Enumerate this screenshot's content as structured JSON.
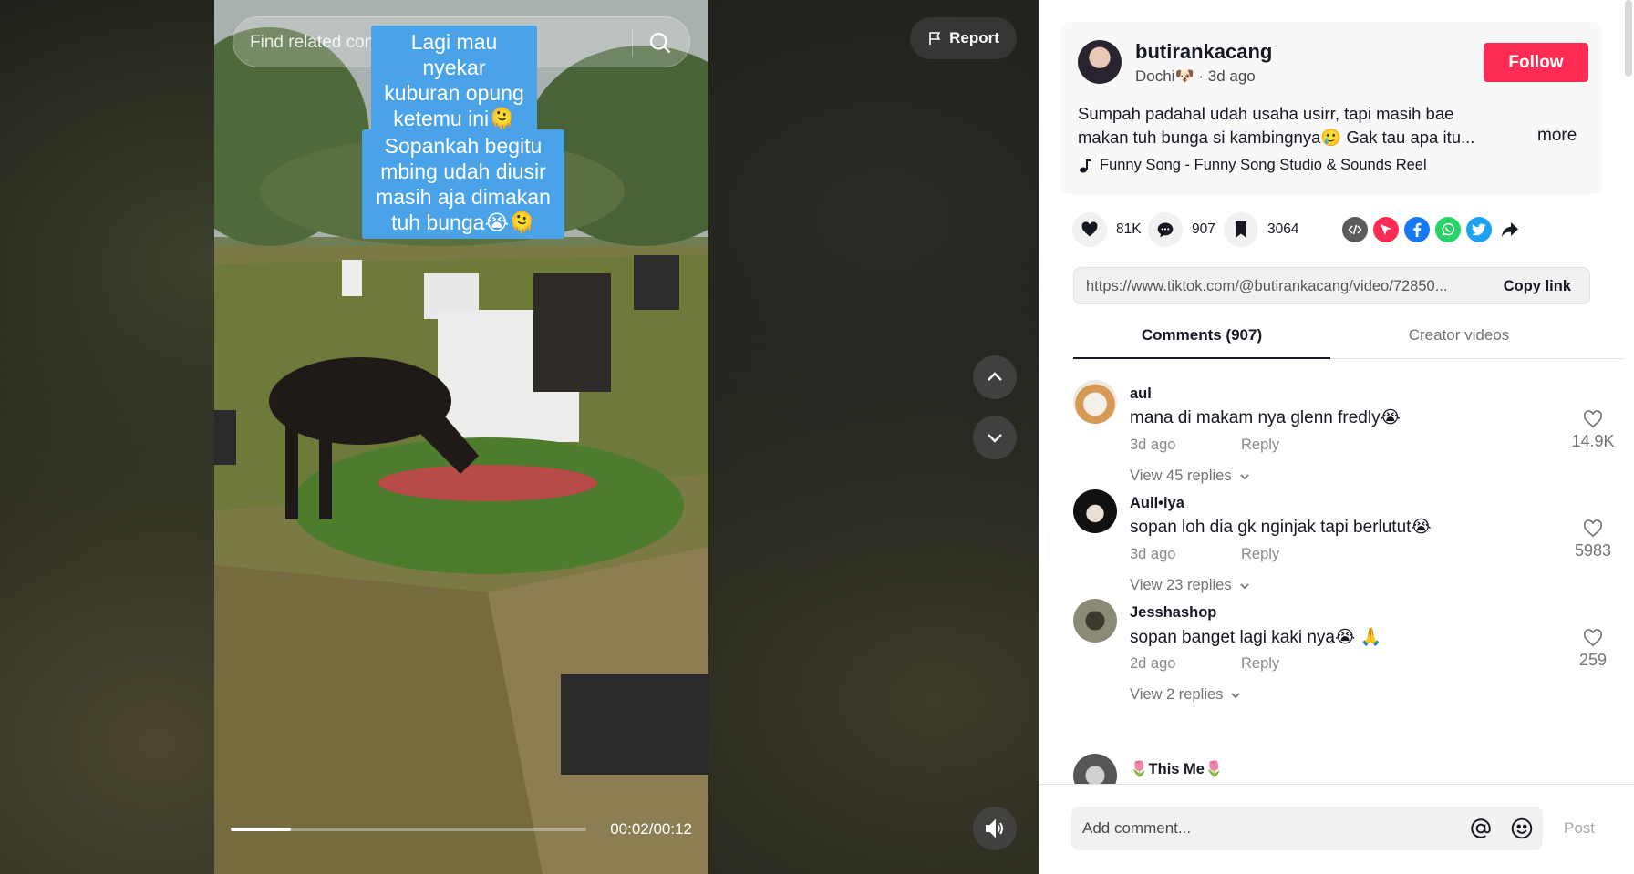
{
  "video": {
    "search_placeholder": "Find related content",
    "caption_top": "Lagi mau nyekar kuburan opung ketemu ini🫠",
    "caption_bottom": "Sopankah begitu mbing udah diusir masih aja dimakan tuh bunga😭🫠",
    "time": "00:02/00:12",
    "progress_fraction": 0.17,
    "report_label": "Report"
  },
  "post": {
    "username": "butirankacang",
    "nickname": "Dochi🐶",
    "age": "3d ago",
    "follow_label": "Follow",
    "description": "Sumpah padahal udah usaha usirr, tapi masih bae makan tuh bunga si kambingnya🥲 Gak tau apa itu...",
    "more_label": "more",
    "music": "Funny Song - Funny Song Studio & Sounds Reel",
    "likes": "81K",
    "comments": "907",
    "saves": "3064",
    "link": "https://www.tiktok.com/@butirankacang/video/72850...",
    "copy_link_label": "Copy link"
  },
  "tabs": {
    "comments": "Comments (907)",
    "creator": "Creator videos"
  },
  "comments": [
    {
      "user": "aul",
      "text": "mana di makam nya glenn fredly😭",
      "age": "3d ago",
      "reply": "Reply",
      "view": "View 45 replies",
      "likes": "14.9K"
    },
    {
      "user": "Aull•iya",
      "text": "sopan loh dia gk nginjak tapi berlutut😭",
      "age": "3d ago",
      "reply": "Reply",
      "view": "View 23 replies",
      "likes": "5983"
    },
    {
      "user": "Jesshashop",
      "text": "sopan banget lagi kaki nya😭 🙏",
      "age": "2d ago",
      "reply": "Reply",
      "view": "View 2 replies",
      "likes": "259"
    },
    {
      "user": "🌷This Me🌷"
    }
  ],
  "composer": {
    "placeholder": "Add comment...",
    "post_label": "Post"
  },
  "colors": {
    "follow": "#fe2c55",
    "caption_bg": "#4aa3e8",
    "facebook": "#1877f2",
    "whatsapp": "#25d366",
    "twitter": "#1da1f2",
    "repost": "#fe2c55"
  }
}
